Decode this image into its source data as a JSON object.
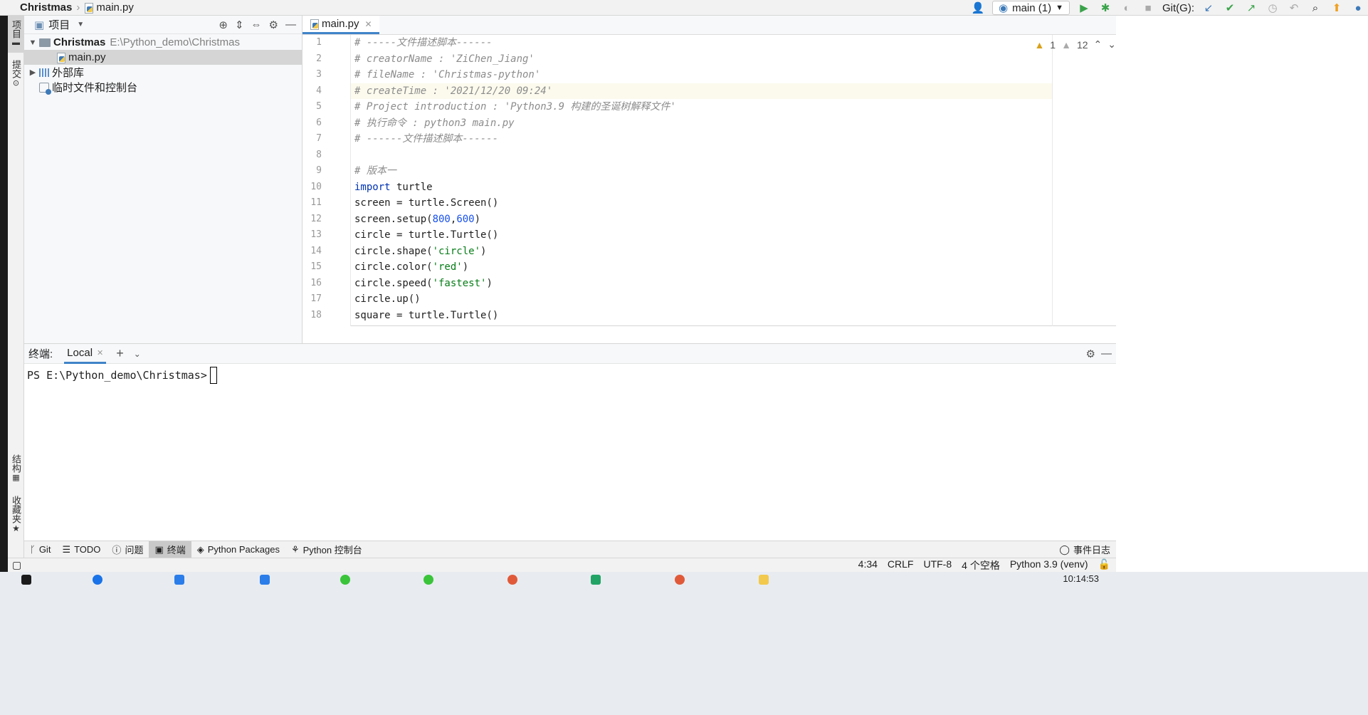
{
  "breadcrumb": {
    "project": "Christmas",
    "file": "main.py"
  },
  "toolbar": {
    "run_config": "main (1)",
    "git_label": "Git(G):"
  },
  "left_strip": {
    "project_tab": "项目",
    "commit_tab": "提交",
    "structure_tab": "结构",
    "favorites_tab": "收藏夹"
  },
  "project_panel": {
    "title": "项目",
    "root_name": "Christmas",
    "root_path": "E:\\Python_demo\\Christmas",
    "file": "main.py",
    "external_libs": "外部库",
    "scratches": "临时文件和控制台"
  },
  "editor": {
    "tab": "main.py",
    "warnings": "1",
    "weak_warnings": "12",
    "line_numbers": [
      "1",
      "2",
      "3",
      "4",
      "5",
      "6",
      "7",
      "8",
      "9",
      "10",
      "11",
      "12",
      "13",
      "14",
      "15",
      "16",
      "17",
      "18"
    ],
    "lines": [
      "# -----文件描述脚本------",
      "# creatorName : 'ZiChen_Jiang'",
      "# fileName : 'Christmas-python'",
      "# createTime : '2021/12/20 09:24'",
      "# Project introduction : 'Python3.9 构建的圣诞树解释文件'",
      "# 执行命令 : python3 main.py",
      "# ------文件描述脚本------",
      "",
      "# 版本一",
      "import turtle",
      "screen = turtle.Screen()",
      "screen.setup(800,600)",
      "circle = turtle.Turtle()",
      "circle.shape('circle')",
      "circle.color('red')",
      "circle.speed('fastest')",
      "circle.up()",
      "square = turtle.Turtle()"
    ]
  },
  "terminal": {
    "label": "终端:",
    "tab": "Local",
    "prompt": "PS E:\\Python_demo\\Christmas>"
  },
  "bottom_tabs": [
    "Git",
    "TODO",
    "问题",
    "终端",
    "Python Packages",
    "Python 控制台"
  ],
  "event_log": "事件日志",
  "status": {
    "position": "4:34",
    "line_sep": "CRLF",
    "encoding": "UTF-8",
    "indent": "4 个空格",
    "interpreter": "Python 3.9 (venv)"
  },
  "clock": "10:14:53",
  "colors": {
    "accent": "#4083c9",
    "keyword": "#0033b3",
    "string": "#067d17",
    "number": "#1750eb",
    "comment": "#8c8c8c"
  }
}
